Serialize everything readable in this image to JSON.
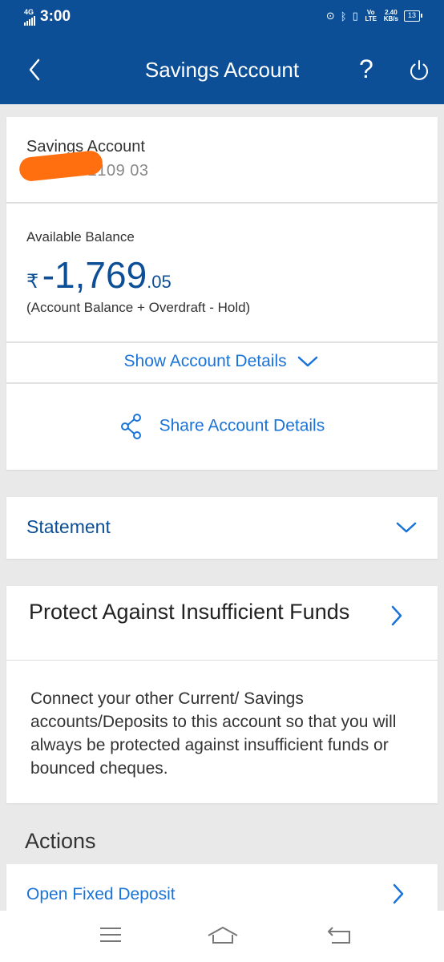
{
  "status_bar": {
    "network": "4G",
    "time": "3:00",
    "volte": "Vo LTE",
    "speed_value": "2.40",
    "speed_unit": "KB/s",
    "battery": "13"
  },
  "header": {
    "title": "Savings Account",
    "help_label": "?",
    "color": "#0c4f96"
  },
  "account": {
    "name": "Savings Account",
    "number": "388 2109 03"
  },
  "balance": {
    "label": "Available Balance",
    "currency": "₹",
    "main": "-1,769",
    "decimal": ".05",
    "note": "(Account Balance + Overdraft - Hold)"
  },
  "links": {
    "show_details": "Show Account Details",
    "share_details": "Share Account Details"
  },
  "statement": {
    "label": "Statement"
  },
  "protect": {
    "title": "Protect Against Insufficient Funds",
    "body": "Connect your other Current/ Savings accounts/Deposits to this account so that you will always be protected against insufficient funds or bounced cheques."
  },
  "actions": {
    "title": "Actions",
    "items": [
      {
        "label": "Open Fixed Deposit"
      }
    ]
  },
  "icons": {
    "back": "back-chevron-icon",
    "help": "help-icon",
    "power": "power-icon",
    "share": "share-icon",
    "chevron_down": "chevron-down-icon",
    "chevron_right": "chevron-right-icon",
    "nav_menu": "menu-icon",
    "nav_home": "home-icon",
    "nav_back": "back-icon"
  },
  "colors": {
    "accent": "#1a73d8",
    "brand": "#0c4f96",
    "redaction": "#ff6f0f"
  }
}
